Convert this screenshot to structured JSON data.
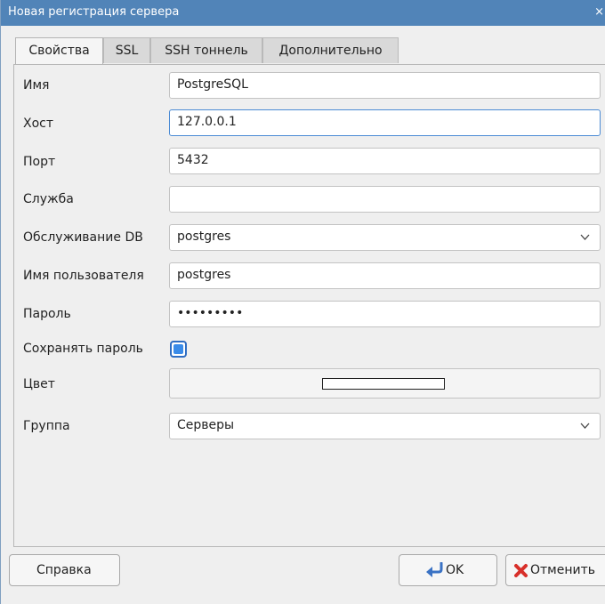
{
  "window": {
    "title": "Новая регистрация сервера",
    "close_glyph": "×"
  },
  "tabs": [
    {
      "label": "Свойства",
      "active": true
    },
    {
      "label": "SSL",
      "active": false
    },
    {
      "label": "SSH тоннель",
      "active": false
    },
    {
      "label": "Дополнительно",
      "active": false
    }
  ],
  "fields": {
    "name": {
      "label": "Имя",
      "value": "PostgreSQL"
    },
    "host": {
      "label": "Хост",
      "value": "127.0.0.1"
    },
    "port": {
      "label": "Порт",
      "value": "5432"
    },
    "service": {
      "label": "Служба",
      "value": ""
    },
    "maintenance_db": {
      "label": "Обслуживание DB",
      "value": "postgres"
    },
    "username": {
      "label": "Имя пользователя",
      "value": "postgres"
    },
    "password": {
      "label": "Пароль",
      "value": "•••••••••"
    },
    "save_password": {
      "label": "Сохранять пароль",
      "checked": true
    },
    "color": {
      "label": "Цвет",
      "swatch_color": "#ffffff"
    },
    "group": {
      "label": "Группа",
      "value": "Серверы"
    }
  },
  "buttons": {
    "help": "Справка",
    "ok": "OK",
    "cancel": "Отменить"
  },
  "icons": {
    "close": "close-icon",
    "dropdown": "chevron-down-icon",
    "ok": "return-arrow-icon",
    "cancel": "red-x-icon"
  },
  "colors": {
    "titlebar": "#5184b8",
    "focus_border": "#4b8bd4",
    "checkbox_fill": "#3a8be8"
  }
}
